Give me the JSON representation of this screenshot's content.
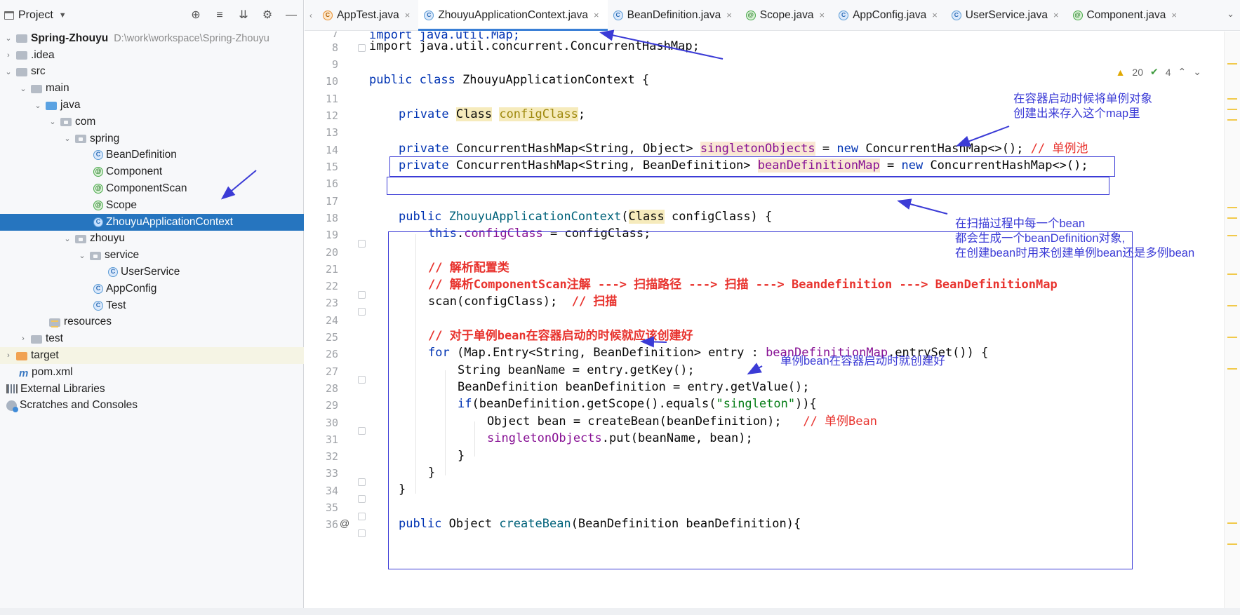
{
  "project_panel": {
    "title": "Project",
    "tools": [
      "crosshair-icon",
      "expand-all-icon",
      "collapse-all-icon",
      "gear-icon",
      "minimize-icon"
    ],
    "root": {
      "name": "Spring-Zhouyu",
      "path": "D:\\work\\workspace\\Spring-Zhouyu"
    },
    "items": {
      "idea": ".idea",
      "src": "src",
      "main": "main",
      "java": "java",
      "com": "com",
      "spring": "spring",
      "bean_definition": "BeanDefinition",
      "component": "Component",
      "component_scan": "ComponentScan",
      "scope": "Scope",
      "zhouyu_app_ctx": "ZhouyuApplicationContext",
      "zhouyu": "zhouyu",
      "service": "service",
      "user_service": "UserService",
      "app_config": "AppConfig",
      "test_class": "Test",
      "resources": "resources",
      "test": "test",
      "target": "target",
      "pom": "pom.xml",
      "external_libraries": "External Libraries",
      "scratches": "Scratches and Consoles"
    }
  },
  "tabs": [
    {
      "label": "AppTest.java",
      "icon": "c",
      "active": false
    },
    {
      "label": "ZhouyuApplicationContext.java",
      "icon": "c",
      "active": true
    },
    {
      "label": "BeanDefinition.java",
      "icon": "c",
      "active": false
    },
    {
      "label": "Scope.java",
      "icon": "@",
      "active": false
    },
    {
      "label": "AppConfig.java",
      "icon": "c",
      "active": false
    },
    {
      "label": "UserService.java",
      "icon": "c",
      "active": false
    },
    {
      "label": "Component.java",
      "icon": "@",
      "active": false
    }
  ],
  "inspections": {
    "warnings": "20",
    "ok": "4"
  },
  "line_numbers": [
    "7",
    "8",
    "9",
    "10",
    "11",
    "12",
    "13",
    "14",
    "15",
    "16",
    "17",
    "18",
    "19",
    "20",
    "21",
    "22",
    "23",
    "24",
    "25",
    "26",
    "27",
    "28",
    "29",
    "30",
    "31",
    "32",
    "33",
    "34",
    "35",
    "36"
  ],
  "code": {
    "l7": "import java.util.Map;",
    "l8": "import java.util.concurrent.ConcurrentHashMap;",
    "l10_kw": "public class ",
    "l10_name": "ZhouyuApplicationContext {",
    "l12_kw": "private ",
    "l12_type": "Class",
    "l12_field": "configClass",
    "l12_end": ";",
    "l14_kw": "private ",
    "l14_type": "ConcurrentHashMap<String, Object> ",
    "l14_field": "singletonObjects",
    "l14_eq": " = ",
    "l14_new": "new ",
    "l14_rest": "ConcurrentHashMap<>(); ",
    "l14_cmt": "// 单例池",
    "l15_kw": "private ",
    "l15_type": "ConcurrentHashMap<String, BeanDefinition> ",
    "l15_field": "beanDefinitionMap",
    "l15_eq": " = ",
    "l15_new": "new ",
    "l15_rest": "ConcurrentHashMap<>();",
    "l18_kw": "public ",
    "l18_name": "ZhouyuApplicationContext",
    "l18_open": "(",
    "l18_type": "Class",
    "l18_rest": " configClass) {",
    "l19_this": "this",
    "l19_dot": ".",
    "l19_field": "configClass",
    "l19_rest": " = configClass;",
    "l21": "// 解析配置类",
    "l22": "// 解析ComponentScan注解 ---> 扫描路径 ---> 扫描 ---> Beandefinition ---> BeanDefinitionMap",
    "l23_code": "scan(configClass);  ",
    "l23_cmt": "// 扫描",
    "l25": "// 对于单例bean在容器启动的时候就应该创建好",
    "l26_kw": "for ",
    "l26_a": "(Map.Entry<String, BeanDefinition> entry : ",
    "l26_field": "beanDefinitionMap",
    "l26_b": ".entrySet()) {",
    "l27": "String beanName = entry.getKey();",
    "l28": "BeanDefinition beanDefinition = entry.getValue();",
    "l29_kw": "if",
    "l29_a": "(beanDefinition.getScope().equals(",
    "l29_str": "\"singleton\"",
    "l29_b": ")){",
    "l30_code": "Object bean = createBean(beanDefinition);   ",
    "l30_cmt": "// 单例Bean",
    "l31_field": "singletonObjects",
    "l31_rest": ".put(beanName, bean);",
    "l32": "}",
    "l33": "}",
    "l34": "}",
    "l36_kw": "public ",
    "l36_a": "Object ",
    "l36_fn": "createBean",
    "l36_b": "(BeanDefinition beanDefinition){"
  },
  "annotations": {
    "note_singleton_line1": "在容器启动时候将单例对象",
    "note_singleton_line2": "创建出来存入这个map里",
    "note_scan_line1": "在扫描过程中每一个bean",
    "note_scan_line2": "都会生成一个beanDefinition对象,",
    "note_scan_line3": "在创建bean时用来创建单例bean还是多例bean",
    "note_startup": "单例bean在容器启动时就创建好"
  },
  "colors": {
    "annotation_blue": "#3b3bd6",
    "comment_red": "#e8332e",
    "keyword": "#0033b3",
    "field": "#871094",
    "selection": "#2675bf"
  }
}
